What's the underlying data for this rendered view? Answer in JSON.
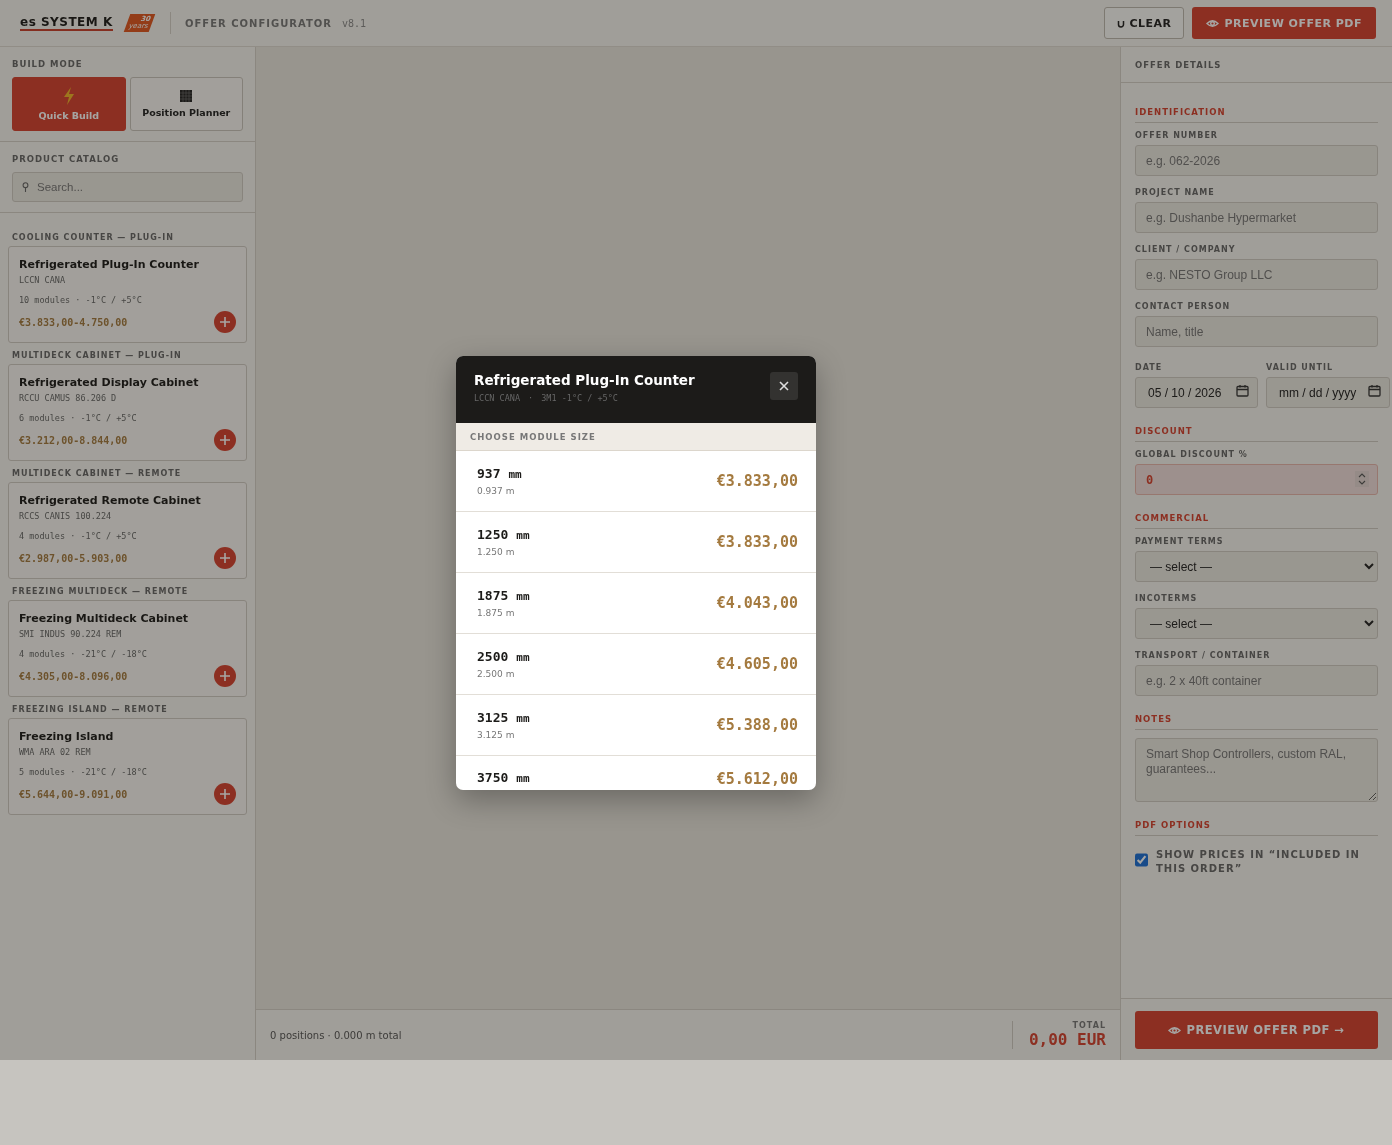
{
  "header": {
    "logo": "es SYSTEM K",
    "badge_number": "30",
    "badge_word": "years",
    "title": "OFFER CONFIGURATOR",
    "version": "v8.1",
    "clear_button": "CLEAR",
    "preview_button": "PREVIEW OFFER PDF"
  },
  "sidebar": {
    "build_mode_label": "BUILD MODE",
    "modes": [
      {
        "label": "Quick Build",
        "selected": true
      },
      {
        "label": "Position Planner",
        "selected": false
      }
    ],
    "catalog_label": "PRODUCT CATALOG",
    "search": {
      "placeholder": "Search..."
    },
    "groups": [
      {
        "category": "COOLING COUNTER — PLUG-IN",
        "name": "Refrigerated Plug-In Counter",
        "code": "LCCN CANA",
        "specs": "10 modules · -1°C / +5°C",
        "price": "€3.833,00-4.750,00"
      },
      {
        "category": "MULTIDECK CABINET — PLUG-IN",
        "name": "Refrigerated Display Cabinet",
        "code": "RCCU CAMUS 86.206 D",
        "specs": "6 modules · -1°C / +5°C",
        "price": "€3.212,00-8.844,00"
      },
      {
        "category": "MULTIDECK CABINET — REMOTE",
        "name": "Refrigerated Remote Cabinet",
        "code": "RCCS CANIS 100.224",
        "specs": "4 modules · -1°C / +5°C",
        "price": "€2.987,00-5.903,00"
      },
      {
        "category": "FREEZING MULTIDECK — REMOTE",
        "name": "Freezing Multideck Cabinet",
        "code": "SMI INDUS 90.224 REM",
        "specs": "4 modules · -21°C / -18°C",
        "price": "€4.305,00-8.096,00"
      },
      {
        "category": "FREEZING ISLAND — REMOTE",
        "name": "Freezing Island",
        "code": "WMA ARA 02 REM",
        "specs": "5 modules · -21°C / -18°C",
        "price": "€5.644,00-9.091,00"
      }
    ]
  },
  "footer": {
    "summary": "0 positions · 0.000 m total",
    "total_label": "TOTAL",
    "total": "0,00 EUR"
  },
  "details": {
    "title": "OFFER DETAILS",
    "sections": [
      {
        "heading": "IDENTIFICATION",
        "fields": [
          {
            "kind": "text",
            "label": "OFFER NUMBER",
            "placeholder": "e.g. 062-2026"
          },
          {
            "kind": "text",
            "label": "PROJECT NAME",
            "placeholder": "e.g. Dushanbe Hypermarket"
          },
          {
            "kind": "text",
            "label": "CLIENT / COMPANY",
            "placeholder": "e.g. NESTO Group LLC"
          },
          {
            "kind": "text",
            "label": "CONTACT PERSON",
            "placeholder": "Name, title"
          },
          {
            "kind": "dates",
            "items": [
              {
                "label": "DATE",
                "value": "05 / 10 / 2026"
              },
              {
                "label": "VALID UNTIL",
                "placeholder": "mm / dd / yyyy"
              }
            ]
          }
        ]
      },
      {
        "heading": "DISCOUNT",
        "fields": [
          {
            "kind": "number",
            "label": "GLOBAL DISCOUNT %",
            "value": "0"
          }
        ]
      },
      {
        "heading": "COMMERCIAL",
        "fields": [
          {
            "kind": "select",
            "label": "PAYMENT TERMS",
            "value": "— select —"
          },
          {
            "kind": "select",
            "label": "INCOTERMS",
            "value": "— select —"
          },
          {
            "kind": "text",
            "label": "TRANSPORT / CONTAINER",
            "placeholder": "e.g. 2 x 40ft container"
          }
        ]
      },
      {
        "heading": "NOTES",
        "fields": [
          {
            "kind": "textarea",
            "placeholder": "Smart Shop Controllers, custom RAL, guarantees..."
          }
        ]
      },
      {
        "heading": "PDF OPTIONS",
        "fields": [
          {
            "kind": "checkbox",
            "label": "SHOW PRICES IN “INCLUDED IN THIS ORDER”",
            "checked": true
          }
        ]
      }
    ],
    "preview_button": "PREVIEW OFFER PDF →"
  },
  "modal": {
    "title": "Refrigerated Plug-In Counter",
    "code": "LCCN CANA",
    "separator": "·",
    "spec": "3M1 -1°C / +5°C",
    "section_label": "CHOOSE MODULE SIZE",
    "sizes": [
      {
        "size": "937",
        "unit": "mm",
        "meters": "0.937 m",
        "price": "€3.833,00"
      },
      {
        "size": "1250",
        "unit": "mm",
        "meters": "1.250 m",
        "price": "€3.833,00"
      },
      {
        "size": "1875",
        "unit": "mm",
        "meters": "1.875 m",
        "price": "€4.043,00"
      },
      {
        "size": "2500",
        "unit": "mm",
        "meters": "2.500 m",
        "price": "€4.605,00"
      },
      {
        "size": "3125",
        "unit": "mm",
        "meters": "3.125 m",
        "price": "€5.388,00"
      },
      {
        "size": "3750",
        "unit": "mm",
        "price": "€5.612,00"
      }
    ]
  }
}
